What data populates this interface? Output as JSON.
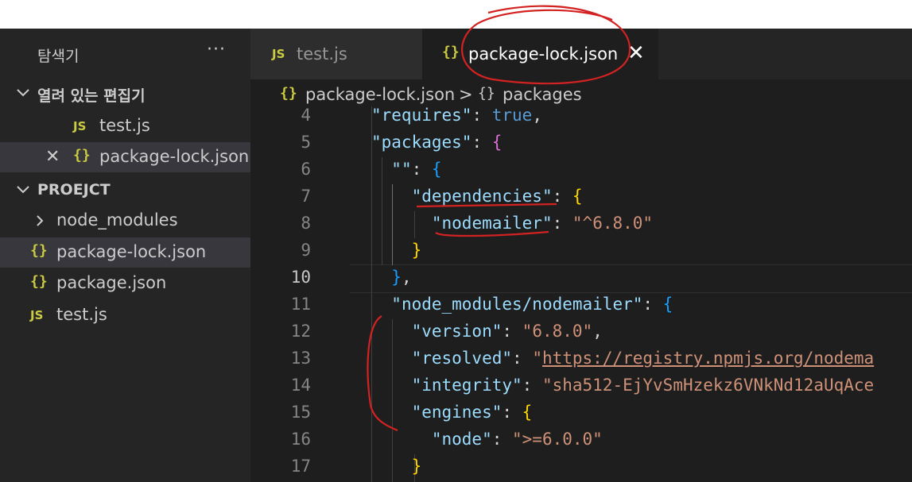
{
  "sidebar": {
    "title": "탐색기",
    "more_icon": "ellipsis-icon",
    "open_editors": {
      "header": "열려 있는 편집기",
      "items": [
        {
          "badge": "JS",
          "label": "test.js"
        },
        {
          "badge": "{}",
          "label": "package-lock.json"
        }
      ]
    },
    "project": {
      "header": "PROEJCT",
      "items": [
        {
          "badge": "",
          "label": "node_modules"
        },
        {
          "badge": "{}",
          "label": "package-lock.json"
        },
        {
          "badge": "{}",
          "label": "package.json"
        },
        {
          "badge": "JS",
          "label": "test.js"
        }
      ]
    }
  },
  "tabs": [
    {
      "badge": "JS",
      "label": "test.js",
      "active": false
    },
    {
      "badge": "{}",
      "label": "package-lock.json",
      "active": true
    }
  ],
  "breadcrumb": {
    "items": [
      "package-lock.json",
      "packages"
    ],
    "separator": ">"
  },
  "editor": {
    "active_line": "10",
    "lines": [
      {
        "num": "4",
        "key": "\"requires\"",
        "sep": ": ",
        "val": "true",
        "tail": ","
      },
      {
        "num": "5",
        "key": "\"packages\"",
        "sep": ": ",
        "open": "{"
      },
      {
        "num": "6",
        "key": "\"\"",
        "sep": ": ",
        "open": "{"
      },
      {
        "num": "7",
        "key_q1": "\"",
        "key_name": "dependencies",
        "key_q2": "\"",
        "sep": ": ",
        "open": "{"
      },
      {
        "num": "8",
        "key_q1": "\"",
        "key_name": "nodemailer",
        "key_q2": "\"",
        "sep": ": ",
        "val": "\"^6.8.0\""
      },
      {
        "num": "9",
        "close": "}"
      },
      {
        "num": "10",
        "close": "}",
        "tail": ","
      },
      {
        "num": "11",
        "key": "\"node_modules/nodemailer\"",
        "sep": ": ",
        "open": "{"
      },
      {
        "num": "12",
        "key": "\"version\"",
        "sep": ": ",
        "val": "\"6.8.0\"",
        "tail": ","
      },
      {
        "num": "13",
        "key": "\"resolved\"",
        "sep": ": ",
        "q": "\"",
        "val": "https://registry.npmjs.org/nodema"
      },
      {
        "num": "14",
        "key": "\"integrity\"",
        "sep": ": ",
        "val": "\"sha512-EjYvSmHzekz6VNkNd12aUqAce"
      },
      {
        "num": "15",
        "key": "\"engines\"",
        "sep": ": ",
        "open": "{"
      },
      {
        "num": "16",
        "key": "\"node\"",
        "sep": ": ",
        "val": "\">=6.0.0\""
      },
      {
        "num": "17",
        "close": "}"
      }
    ]
  },
  "colors": {
    "sidebar_bg": "#252526",
    "editor_bg": "#1e1e1e",
    "json_key": "#9cdcfe",
    "json_string": "#ce9178",
    "keyword": "#569cd6",
    "annotation_red": "#d32222"
  }
}
